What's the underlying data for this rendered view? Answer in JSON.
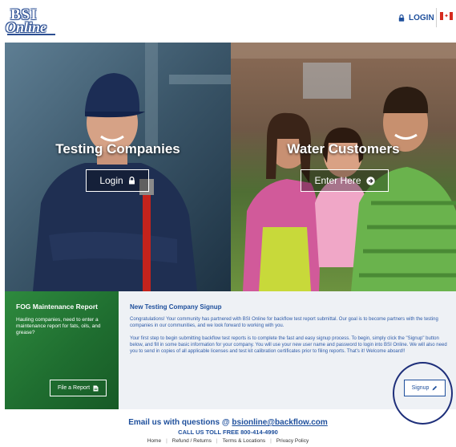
{
  "header": {
    "logo_top": "BSI",
    "logo_bottom": "Online",
    "login_label": "LOGIN",
    "flag": "canada-flag"
  },
  "testing": {
    "title": "Testing Companies",
    "button_label": "Login"
  },
  "water": {
    "title": "Water Customers",
    "button_label": "Enter Here"
  },
  "fog": {
    "title": "FOG Maintenance Report",
    "description": "Hauling companies, need to enter a maintenance report for fats, oils, and grease?",
    "button_label": "File a Report"
  },
  "signup": {
    "title": "New Testing Company Signup",
    "paragraph1": "Congratulations! Your community has partnered with BSI Online for backflow test report submittal. Our goal is to become partners with the testing companies in our communities, and we look forward to working with you.",
    "paragraph2": "Your first step to begin submitting backflow test reports is to complete the fast and easy signup process. To begin, simply click the \"Signup\" button below, and fill in some basic information for your company. You will use your new user name and password to login into BSI Online. We will also need you to send in copies of all applicable licenses and test kit calibration certificates prior to filing reports. That's it! Welcome aboard!!",
    "button_label": "Signup"
  },
  "footer": {
    "email_prefix": "Email us with questions @",
    "email": "bsionline@backflow.com",
    "call": "CALL US TOLL FREE 800-414-4990",
    "nav": [
      "Home",
      "Refund / Returns",
      "Terms & Locations",
      "Privacy Policy"
    ]
  },
  "colors": {
    "brand_blue": "#1e4f9c",
    "fog_green": "#1f6e30",
    "annotation_circle": "#1e2f7a"
  }
}
